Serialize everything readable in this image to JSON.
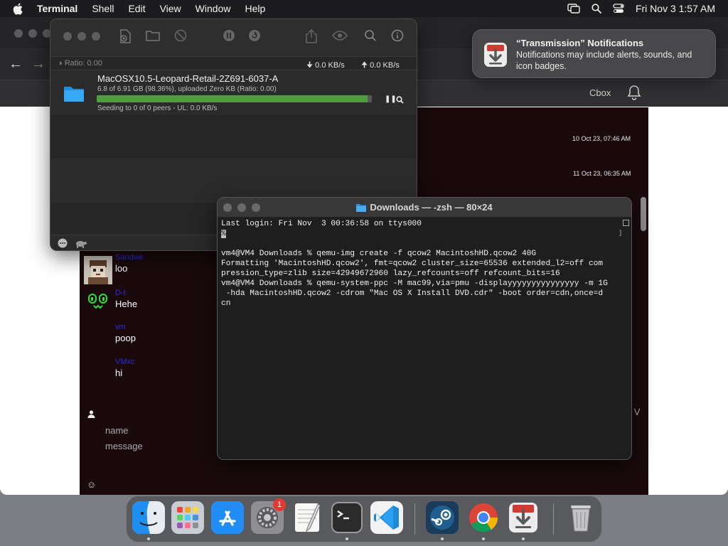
{
  "menubar": {
    "items": [
      {
        "label": "Terminal",
        "bold": true
      },
      {
        "label": "Shell"
      },
      {
        "label": "Edit"
      },
      {
        "label": "View"
      },
      {
        "label": "Window"
      },
      {
        "label": "Help"
      }
    ],
    "clock": "Fri Nov 3  1:57 AM",
    "icons": [
      "apple-icon",
      "screen-mirroring-icon",
      "spotlight-search-icon",
      "control-center-icon"
    ]
  },
  "browser": {
    "tab_label": "Cbox",
    "timestamps": [
      "10 Oct 23, 07:46 AM",
      "11 Oct 23, 06:35 AM"
    ],
    "messages": [
      {
        "username": "Sandwe",
        "text": "loo"
      },
      {
        "username": "D-t",
        "text": "Hehe"
      },
      {
        "username": "vm",
        "text": "poop"
      },
      {
        "username": "VMxc",
        "text": "hi"
      }
    ],
    "name_placeholder": "name",
    "message_placeholder": "message"
  },
  "transmission": {
    "ratio": "Ratio: 0.00",
    "download_speed": "0.0 KB/s",
    "upload_speed": "0.0 KB/s",
    "torrent": {
      "name": "MacOSX10.5-Leopard-Retail-2Z691-6037-A",
      "progress_text": "6.8 of 6.91 GB (98.36%), uploaded Zero KB (Ratio: 0.00)",
      "progress_percent": 98.36,
      "status": "Seeding to 0 of 0 peers - UL: 0.0 KB/s"
    }
  },
  "terminal": {
    "title": "Downloads — -zsh — 80×24",
    "lines": [
      "Last login: Fri Nov  3 00:36:58 on ttys000",
      "%",
      "vm4@VM4 Downloads % qemu-img create -f qcow2 MacintoshHD.qcow2 40G",
      "Formatting 'MacintoshHD.qcow2', fmt=qcow2 cluster_size=65536 extended_l2=off com",
      "pression_type=zlib size=42949672960 lazy_refcounts=off refcount_bits=16",
      "vm4@VM4 Downloads % qemu-system-ppc -M mac99,via=pmu -displayyyyyyyyyyyyyyy -m 1G",
      " -hda MacintoshHD.qcow2 -cdrom \"Mac OS X Install DVD.cdr\" -boot order=cdn,once=d",
      "cn"
    ]
  },
  "notification": {
    "title": "“Transmission” Notifications",
    "body": "Notifications may include alerts, sounds, and icon badges."
  },
  "dock": {
    "items": [
      {
        "name": "finder",
        "running": true
      },
      {
        "name": "launchpad",
        "running": false
      },
      {
        "name": "app-store",
        "running": false
      },
      {
        "name": "system-settings",
        "running": false,
        "badge": "1"
      },
      {
        "name": "textedit",
        "running": false
      },
      {
        "name": "terminal",
        "running": true
      },
      {
        "name": "visual-studio-code",
        "running": false
      },
      {
        "name": "steam",
        "running": true
      },
      {
        "name": "google-chrome",
        "running": true
      },
      {
        "name": "transmission",
        "running": true
      },
      {
        "name": "trash",
        "running": false
      }
    ]
  }
}
